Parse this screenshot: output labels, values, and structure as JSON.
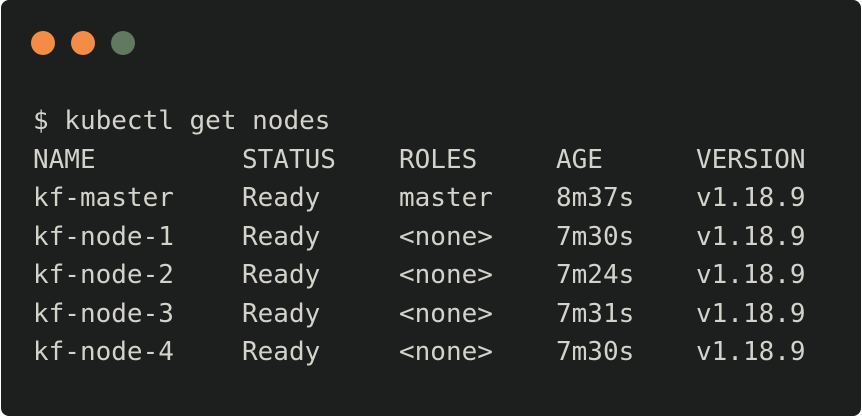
{
  "window": {
    "controls": [
      {
        "name": "close",
        "color": "#f58c46"
      },
      {
        "name": "minimize",
        "color": "#f58c46"
      },
      {
        "name": "maximize",
        "color": "#61795f"
      }
    ]
  },
  "terminal": {
    "prompt": "$ kubectl get nodes",
    "headers": [
      "NAME",
      "STATUS",
      "ROLES",
      "AGE",
      "VERSION"
    ],
    "rows": [
      [
        "kf-master",
        "Ready",
        "master",
        "8m37s",
        "v1.18.9"
      ],
      [
        "kf-node-1",
        "Ready",
        "<none>",
        "7m30s",
        "v1.18.9"
      ],
      [
        "kf-node-2",
        "Ready",
        "<none>",
        "7m24s",
        "v1.18.9"
      ],
      [
        "kf-node-3",
        "Ready",
        "<none>",
        "7m31s",
        "v1.18.9"
      ],
      [
        "kf-node-4",
        "Ready",
        "<none>",
        "7m30s",
        "v1.18.9"
      ]
    ]
  }
}
